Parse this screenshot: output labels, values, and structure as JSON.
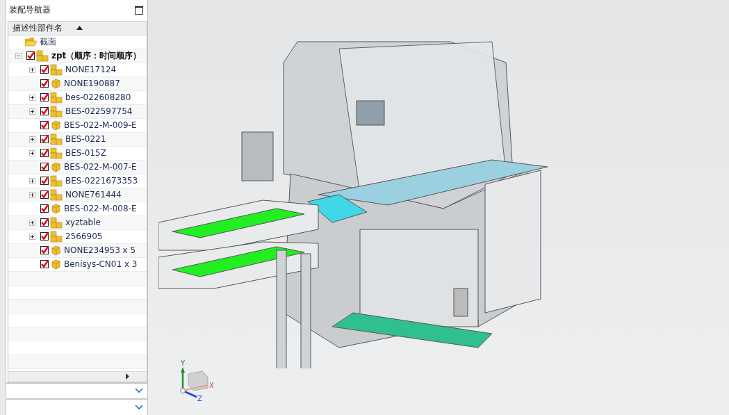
{
  "navigator": {
    "title": "装配导航器",
    "column_header": "描述性部件名",
    "rows": [
      {
        "name": "截面",
        "kind": "folder"
      },
      {
        "name": "zpt（顺序：时间顺序）",
        "kind": "root",
        "checked": true,
        "expanded": true,
        "children": [
          {
            "name": "NONE17124",
            "kind": "assembly",
            "checked": true
          },
          {
            "name": "NONE190887",
            "kind": "part",
            "checked": true
          },
          {
            "name": "bes-022608280",
            "kind": "assembly",
            "checked": true
          },
          {
            "name": "BES-022597754",
            "kind": "assembly",
            "checked": true
          },
          {
            "name": "BES-022-M-009-E",
            "kind": "part",
            "checked": true
          },
          {
            "name": "BES-0221",
            "kind": "assembly",
            "checked": true
          },
          {
            "name": "BES-015Z",
            "kind": "assembly",
            "checked": true
          },
          {
            "name": "BES-022-M-007-E",
            "kind": "part",
            "checked": true
          },
          {
            "name": "BES-0221673353",
            "kind": "assembly",
            "checked": true
          },
          {
            "name": "NONE761444",
            "kind": "assembly",
            "checked": true
          },
          {
            "name": "BES-022-M-008-E",
            "kind": "part",
            "checked": true
          },
          {
            "name": "xyztable",
            "kind": "assembly",
            "checked": true
          },
          {
            "name": "2566905",
            "kind": "assembly",
            "checked": true
          },
          {
            "name": "NONE234953 x 5",
            "kind": "part",
            "checked": true
          },
          {
            "name": "Benisys-CN01 x 3",
            "kind": "part",
            "checked": true
          }
        ]
      }
    ]
  },
  "viewport": {
    "axes": [
      "X",
      "Y",
      "Z"
    ]
  }
}
